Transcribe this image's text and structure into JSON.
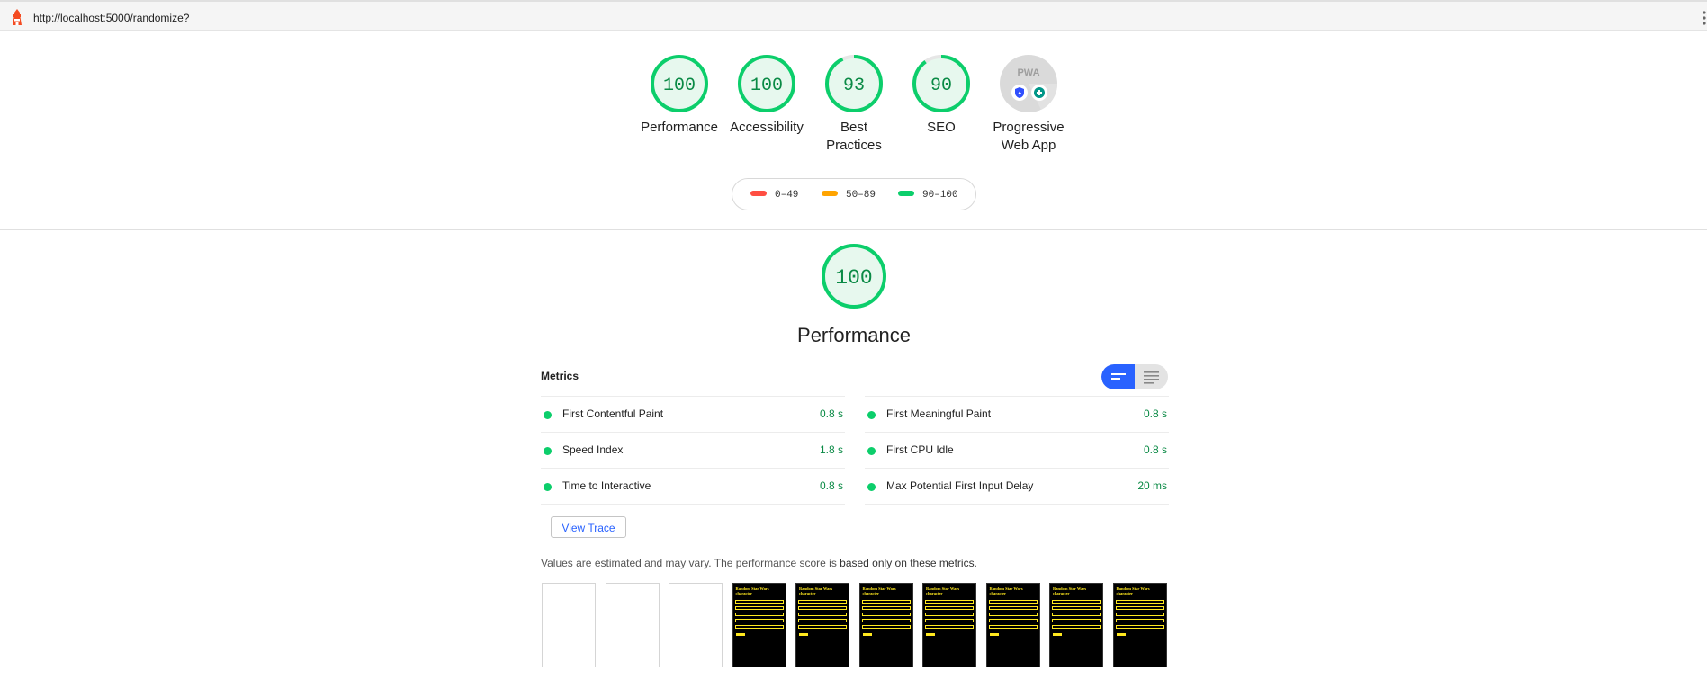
{
  "topbar": {
    "url": "http://localhost:5000/randomize?",
    "logo_icon": "lighthouse-icon",
    "menu_icon": "kebab-menu-icon"
  },
  "categories": [
    {
      "score": "100",
      "label": "Performance"
    },
    {
      "score": "100",
      "label": "Accessibility"
    },
    {
      "score": "93",
      "label": "Best Practices"
    },
    {
      "score": "90",
      "label": "SEO"
    },
    {
      "score": "PWA",
      "label": "Progressive Web App"
    }
  ],
  "legend": {
    "fail": "0–49",
    "average": "50–89",
    "pass": "90–100"
  },
  "colors": {
    "pass": "#0cce6b",
    "average": "#ffa400",
    "fail": "#ff4e42",
    "accent": "#2962ff"
  },
  "performance": {
    "score": "100",
    "title": "Performance",
    "metrics_heading": "Metrics",
    "metrics_left": [
      {
        "name": "First Contentful Paint",
        "value": "0.8 s"
      },
      {
        "name": "Speed Index",
        "value": "1.8 s"
      },
      {
        "name": "Time to Interactive",
        "value": "0.8 s"
      }
    ],
    "metrics_right": [
      {
        "name": "First Meaningful Paint",
        "value": "0.8 s"
      },
      {
        "name": "First CPU Idle",
        "value": "0.8 s"
      },
      {
        "name": "Max Potential First Input Delay",
        "value": "20 ms"
      }
    ],
    "view_trace": "View Trace",
    "note_prefix": "Values are estimated and may vary. The performance score is ",
    "note_link": "based only on these metrics",
    "note_suffix": ".",
    "thumb_title": "Random Star Wars character",
    "thumbnails": [
      "blank",
      "blank",
      "blank",
      "content",
      "content",
      "content",
      "content",
      "content",
      "content",
      "content"
    ]
  }
}
